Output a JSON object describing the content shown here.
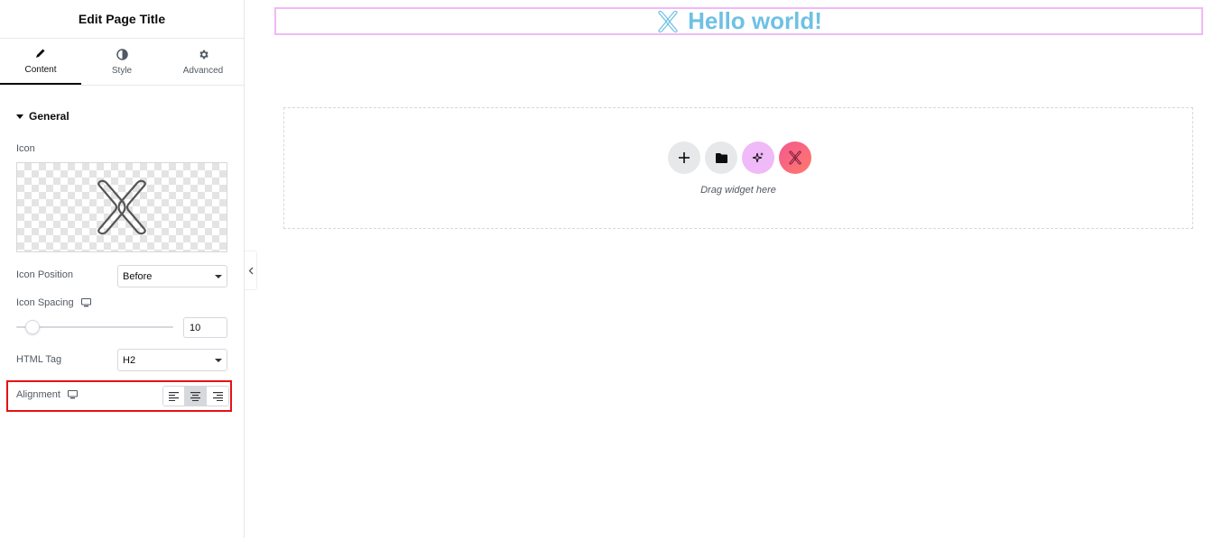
{
  "panel": {
    "title": "Edit Page Title",
    "tabs": [
      {
        "label": "Content",
        "icon": "pencil-icon"
      },
      {
        "label": "Style",
        "icon": "half-circle-icon"
      },
      {
        "label": "Advanced",
        "icon": "gear-icon"
      }
    ],
    "active_tab": "Content",
    "section": {
      "title": "General",
      "icon_label": "Icon",
      "icon_position_label": "Icon Position",
      "icon_position_value": "Before",
      "icon_spacing_label": "Icon Spacing",
      "icon_spacing_value": "10",
      "html_tag_label": "HTML Tag",
      "html_tag_value": "H2",
      "alignment_label": "Alignment",
      "alignment_options": [
        "left",
        "center",
        "right"
      ],
      "alignment_selected": "center"
    }
  },
  "canvas": {
    "heading_text": "Hello world!",
    "heading_color": "#6ec1e4",
    "drop_zone_text": "Drag widget here",
    "drop_buttons": [
      {
        "name": "add-icon",
        "color": "#e6e8ea"
      },
      {
        "name": "folder-icon",
        "color": "#e6e8ea"
      },
      {
        "name": "sparkle-icon",
        "color": "#f0b9f7"
      },
      {
        "name": "x-logo-icon",
        "color": "#f35890"
      }
    ]
  },
  "colors": {
    "highlight_border": "#e61212",
    "selected_widget_border": "#f0b9f7"
  }
}
